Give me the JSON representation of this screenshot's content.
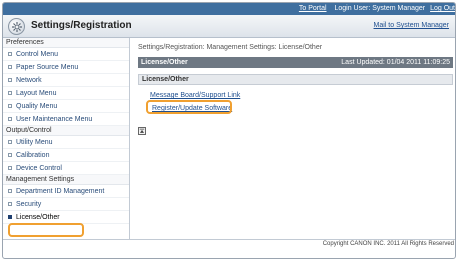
{
  "topbar": {
    "portal_link": "To Portal",
    "login_user": "Login User: System Manager",
    "logout_link": "Log Out"
  },
  "header": {
    "title": "Settings/Registration",
    "mail_link": "Mail to System Manager"
  },
  "sidebar": {
    "sections": [
      {
        "label": "Preferences",
        "items": [
          "Control Menu",
          "Paper Source Menu",
          "Network",
          "Layout Menu",
          "Quality Menu",
          "User Maintenance Menu"
        ]
      },
      {
        "label": "Output/Control",
        "items": [
          "Utility Menu",
          "Calibration",
          "Device Control"
        ]
      },
      {
        "label": "Management Settings",
        "items": [
          "Department ID Management",
          "Security",
          "License/Other"
        ]
      }
    ]
  },
  "main": {
    "breadcrumb": "Settings/Registration: Management Settings: License/Other",
    "panel_title": "License/Other",
    "last_updated": "Last Updated: 01/04 2011 11:09:25",
    "sub_title": "License/Other",
    "links": [
      "Message Board/Support Link",
      "Register/Update Software"
    ]
  },
  "footer": {
    "copyright": "Copyright CANON INC. 2011 All Rights Reserved"
  },
  "colors": {
    "topbar": "#3f6f9f",
    "highlight": "#f0a030",
    "panelbar": "#6e7883"
  }
}
